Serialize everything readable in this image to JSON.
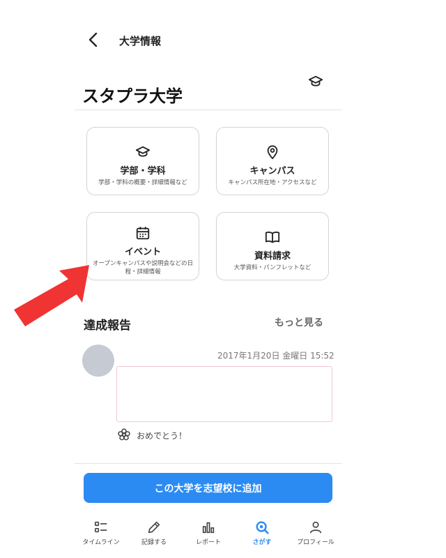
{
  "header": {
    "title": "大学情報"
  },
  "university": {
    "name": "スタプラ大学"
  },
  "cards": [
    {
      "title": "学部・学科",
      "subtitle": "学部・学科の概要・詳細情報など",
      "icon": "graduation-cap-icon"
    },
    {
      "title": "キャンパス",
      "subtitle": "キャンパス所在地・アクセスなど",
      "icon": "map-pin-icon"
    },
    {
      "title": "イベント",
      "subtitle": "オープンキャンパスや説明会などの日程・詳細情報",
      "icon": "calendar-icon"
    },
    {
      "title": "資料請求",
      "subtitle": "大学資料・パンフレットなど",
      "icon": "open-book-icon"
    }
  ],
  "reports": {
    "title": "達成報告",
    "more_label": "もっと見る",
    "post": {
      "date": "2017年1月20日 金曜日 15:52",
      "congrats_label": "おめでとう！"
    }
  },
  "action": {
    "add_label": "この大学を志望校に追加"
  },
  "nav": [
    {
      "label": "タイムライン",
      "icon": "timeline-icon"
    },
    {
      "label": "記録する",
      "icon": "pencil-icon"
    },
    {
      "label": "レポート",
      "icon": "bar-chart-icon"
    },
    {
      "label": "さがす",
      "icon": "search-icon",
      "active": true
    },
    {
      "label": "プロフィール",
      "icon": "person-icon"
    }
  ],
  "colors": {
    "accent": "#2b8bf2",
    "annotation_arrow": "#f03333",
    "avatar": "#c6cad2"
  }
}
